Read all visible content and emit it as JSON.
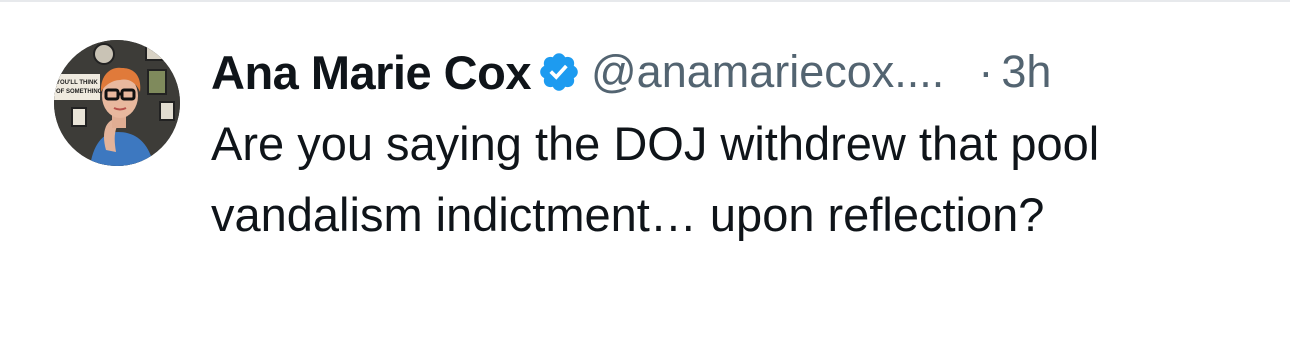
{
  "post": {
    "author": {
      "display_name": "Ana Marie Cox",
      "handle": "@anamariecox....",
      "verified": true,
      "verified_icon": "verified-badge-icon",
      "avatar_poster_text": "YOU'LL THINK OF SOMETHING"
    },
    "time_separator": "·",
    "timestamp": "3h",
    "text": "Are you saying the DOJ withdrew that pool vandalism indictment… upon reflection?"
  },
  "colors": {
    "text_primary": "#0f1419",
    "text_secondary": "#536471",
    "verified_blue": "#1d9bf0",
    "divider": "#e7e9ec"
  }
}
